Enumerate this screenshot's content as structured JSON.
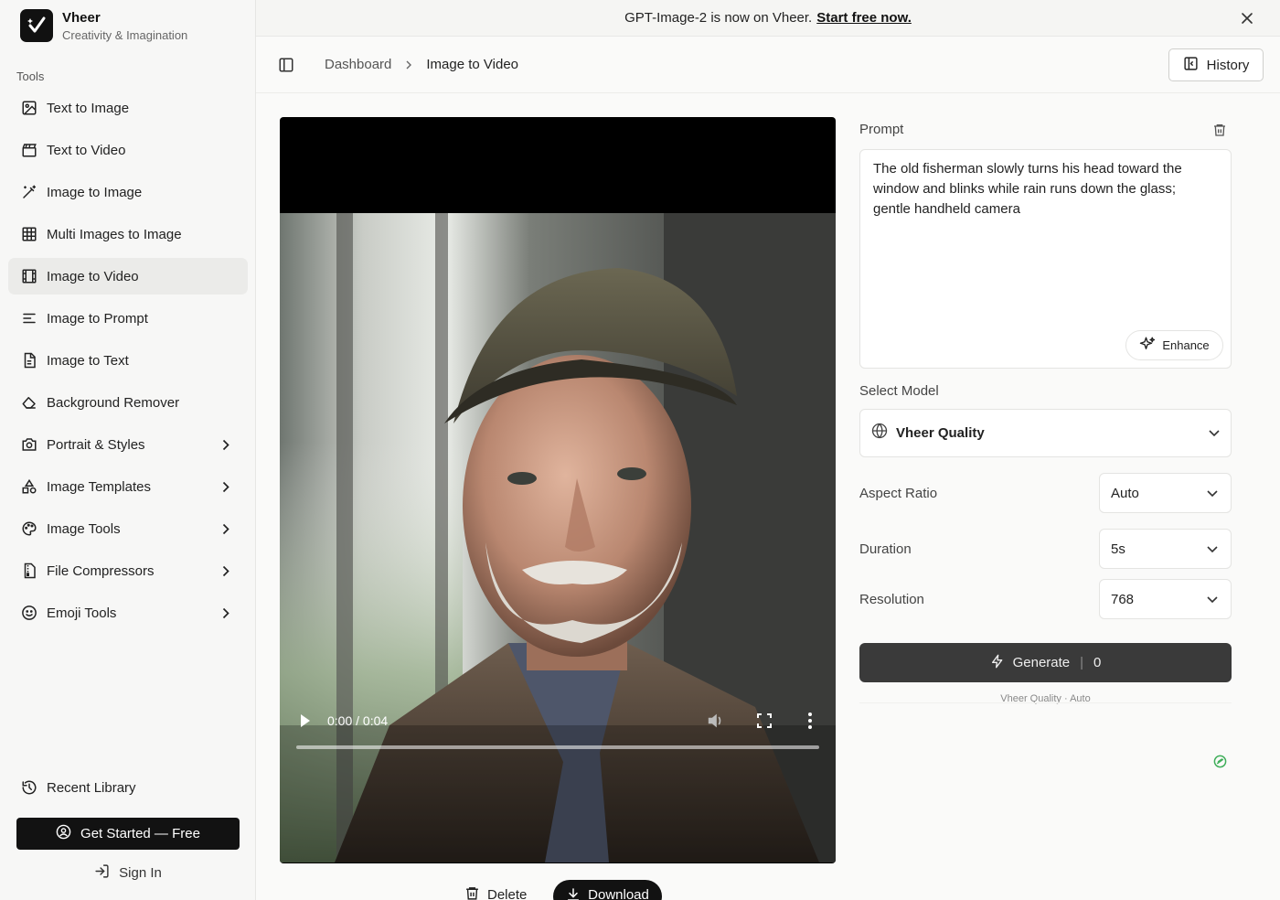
{
  "brand": {
    "name": "Vheer",
    "tagline": "Creativity & Imagination"
  },
  "sidebar": {
    "section_label": "Tools",
    "items": [
      {
        "label": "Text to Image",
        "icon": "image-sparkle-icon",
        "active": false,
        "expandable": false
      },
      {
        "label": "Text to Video",
        "icon": "clapperboard-icon",
        "active": false,
        "expandable": false
      },
      {
        "label": "Image to Image",
        "icon": "magic-wand-icon",
        "active": false,
        "expandable": false
      },
      {
        "label": "Multi Images to Image",
        "icon": "grid-icon",
        "active": false,
        "expandable": false
      },
      {
        "label": "Image to Video",
        "icon": "film-icon",
        "active": true,
        "expandable": false
      },
      {
        "label": "Image to Prompt",
        "icon": "text-lines-icon",
        "active": false,
        "expandable": false
      },
      {
        "label": "Image to Text",
        "icon": "document-icon",
        "active": false,
        "expandable": false
      },
      {
        "label": "Background Remover",
        "icon": "eraser-icon",
        "active": false,
        "expandable": false
      },
      {
        "label": "Portrait & Styles",
        "icon": "camera-icon",
        "active": false,
        "expandable": true
      },
      {
        "label": "Image Templates",
        "icon": "shapes-icon",
        "active": false,
        "expandable": true
      },
      {
        "label": "Image Tools",
        "icon": "palette-icon",
        "active": false,
        "expandable": true
      },
      {
        "label": "File Compressors",
        "icon": "file-zip-icon",
        "active": false,
        "expandable": true
      },
      {
        "label": "Emoji Tools",
        "icon": "smiley-icon",
        "active": false,
        "expandable": true
      }
    ],
    "recent_label": "Recent Library",
    "cta_label": "Get Started — Free",
    "signin_label": "Sign In"
  },
  "banner": {
    "text": "GPT-Image-2 is now on Vheer.",
    "link": "Start free now."
  },
  "header": {
    "breadcrumb": [
      "Dashboard",
      "Image to Video"
    ],
    "history_label": "History"
  },
  "video": {
    "time": "0:00 / 0:04",
    "progress": 0
  },
  "actions": {
    "delete_label": "Delete",
    "download_label": "Download"
  },
  "form": {
    "prompt_label": "Prompt",
    "prompt_text": "The old fisherman slowly turns his head toward the window and blinks while rain runs down the glass; gentle handheld camera",
    "enhance_label": "Enhance",
    "model_label": "Select Model",
    "model_value": "Vheer Quality",
    "aspect_label": "Aspect Ratio",
    "aspect_value": "Auto",
    "duration_label": "Duration",
    "duration_value": "5s",
    "resolution_label": "Resolution",
    "resolution_value": "768",
    "generate_label": "Generate",
    "generate_cost": "0",
    "generate_note": "Vheer Quality · Auto"
  },
  "colors": {
    "accent_dark": "#121212",
    "active_bg": "#ebebe9",
    "status_green": "#3fae5a"
  }
}
